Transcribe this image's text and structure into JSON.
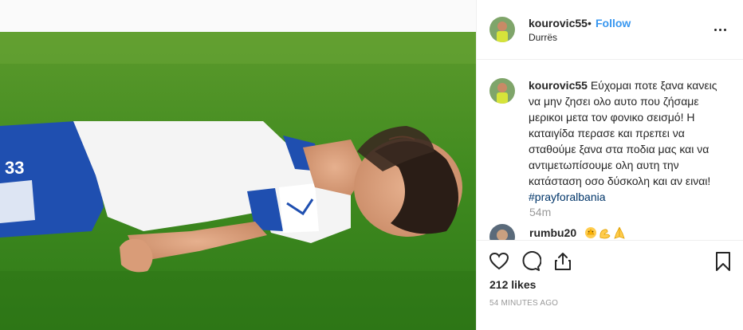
{
  "post": {
    "username": "kourovic55",
    "separator": "•",
    "follow_label": "Follow",
    "location": "Durrës",
    "caption_text": "Εύχομαι ποτε ξανα κανεις να μην ζησει ολο αυτο που ζήσαμε μερικοι μετα τον φονικο σεισμό! Η καταιγίδα περασε και πρεπει να σταθούμε ξανα στα ποδια μας και να αντιμετωπίσουμε ολη αυτη την κατάσταση οσο δύσκολη και αν ειναι!",
    "hashtag": "#prayforalbania",
    "caption_age": "54m",
    "likes": "212 likes",
    "posted_ago": "54 MINUTES AGO"
  },
  "comments": [
    {
      "username": "rumbu20",
      "emojis": [
        "praying-face-emoji",
        "flexed-arm-emoji",
        "praying-hands-emoji"
      ]
    }
  ],
  "actions": {
    "like_icon": "heart-icon",
    "comment_icon": "comment-icon",
    "share_icon": "share-icon",
    "save_icon": "bookmark-icon"
  },
  "colors": {
    "accent": "#3897f0",
    "hashtag": "#003569",
    "muted": "#999999",
    "text": "#262626",
    "grass": "#3f8a1f",
    "jersey_blue": "#1f4fb0"
  }
}
